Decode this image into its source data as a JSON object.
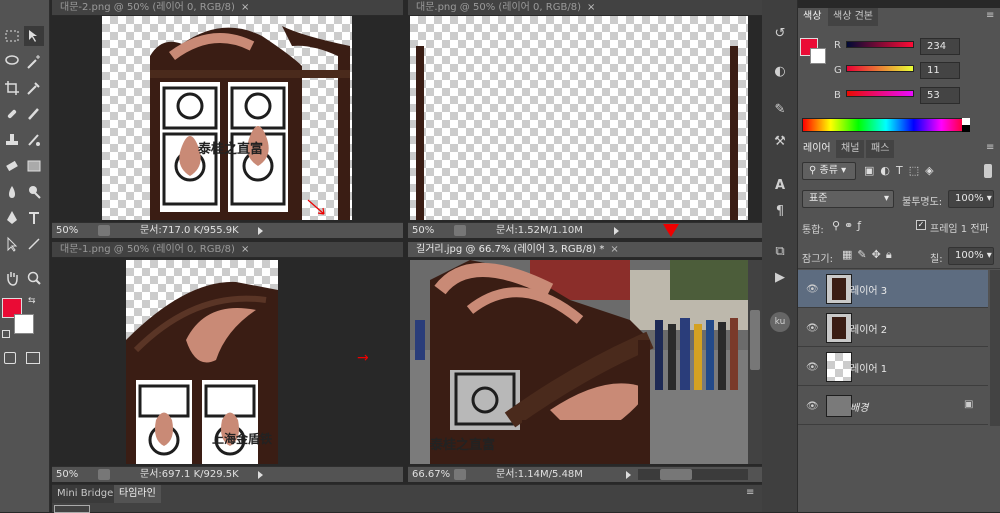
{
  "docs": [
    {
      "title": "대문-2.png @ 50% (레이어 0, RGB/8)",
      "zoom": "50%",
      "info": "문서:717.0 K/955.9K"
    },
    {
      "title": "대문.png @ 50% (레이어 0, RGB/8)",
      "zoom": "50%",
      "info": "문서:1.52M/1.10M"
    },
    {
      "title": "대문-1.png @ 50% (레이어 0, RGB/8)",
      "zoom": "50%",
      "info": "문서:697.1 K/929.5K"
    },
    {
      "title": "길거리.jpg @ 66.7% (레이어 3, RGB/8) *",
      "zoom": "66.67%",
      "info": "문서:1.14M/5.48M"
    }
  ],
  "watermarks": {
    "top_left": "泰桂之直富",
    "bottom_left": "上海金盾铁",
    "bottom_right": "泰桂之直富"
  },
  "timeline": {
    "tab1": "Mini Bridge",
    "tab2": "타임라인"
  },
  "color_panel": {
    "tab1": "색상",
    "tab2": "색상 견본",
    "r_label": "R",
    "g_label": "G",
    "b_label": "B",
    "r": "234",
    "g": "11",
    "b": "53",
    "fg_color": "#ea0b35"
  },
  "layers_panel": {
    "tab1": "레이어",
    "tab2": "채널",
    "tab3": "패스",
    "filter": "종류",
    "blend_mode": "표준",
    "opacity_label": "불투명도:",
    "opacity": "100%",
    "unify_label": "통합:",
    "frame_label": "프레임 1 전파",
    "lock_label": "잠그기:",
    "fill_label": "칠:",
    "fill": "100%",
    "layers": [
      "레이어 3",
      "레이어 2",
      "레이어 1",
      "배경"
    ]
  },
  "colors": {
    "accent": "#ea0b35",
    "selected_layer": "#5d6c80"
  }
}
